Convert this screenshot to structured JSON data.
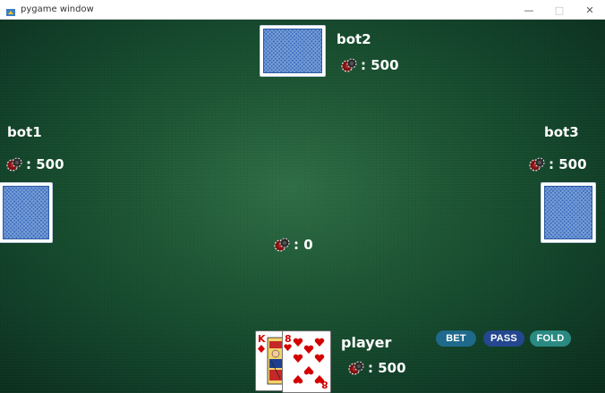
{
  "window": {
    "title": "pygame window"
  },
  "players": {
    "bot2": {
      "name": "bot2",
      "chips": ": 500"
    },
    "bot1": {
      "name": "bot1",
      "chips": ": 500"
    },
    "bot3": {
      "name": "bot3",
      "chips": ": 500"
    },
    "player": {
      "name": "player",
      "chips": ": 500"
    }
  },
  "pot": {
    "chips": ": 0"
  },
  "hand": [
    {
      "rank": "K",
      "suit": "diamond"
    },
    {
      "rank": "8",
      "suit": "heart"
    }
  ],
  "actions": {
    "bet": "BET",
    "pass": "PASS",
    "fold": "FOLD"
  },
  "colors": {
    "felt": "#1d5634",
    "bet": "#1f6a8c",
    "pass": "#24478f",
    "fold": "#2a8a82"
  }
}
